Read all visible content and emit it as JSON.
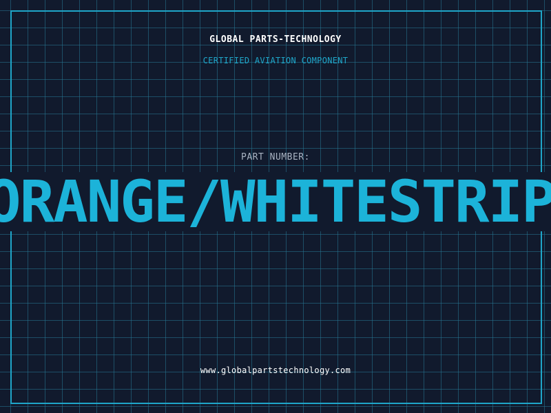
{
  "header": {
    "company": "GLOBAL PARTS-TECHNOLOGY",
    "tagline": "CERTIFIED AVIATION COMPONENT"
  },
  "part": {
    "label": "PART NUMBER:",
    "number": "ORANGE/WHITESTRIPE"
  },
  "footer": {
    "website": "www.globalpartstechnology.com"
  },
  "colors": {
    "background": "#111a2d",
    "accent": "#1fa6c9",
    "part_number": "#1cb3d9",
    "label": "#aab4c3",
    "text": "#ffffff"
  }
}
